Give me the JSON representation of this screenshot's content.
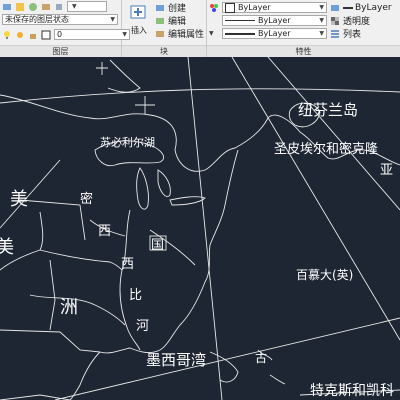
{
  "layers": {
    "row1_dropdown": "",
    "layer_state": "未保存的图层状态",
    "current_layer": "0",
    "title": "图层"
  },
  "block": {
    "insert_label": "插入",
    "create_label": "创建",
    "edit_label": "编辑",
    "edit_attributes_label": "编辑属性",
    "title": "块"
  },
  "properties": {
    "color": "ByLayer",
    "linetype": "ByLayer",
    "lineweight": "ByLayer",
    "title": "特性",
    "color_right": "ByLayer",
    "transparency_label": "透明度",
    "list_label": "列表"
  },
  "map_labels": {
    "newfoundland": "纽芬兰岛",
    "st_pierre": "圣皮埃尔和密克隆",
    "asia_fragment": "亚",
    "superior": "苏必利尔湖",
    "america_1": "美",
    "america_2": "美",
    "mi": "密",
    "xi": "西",
    "guo": "国",
    "xi2": "西",
    "bi": "比",
    "he": "河",
    "zhou": "洲",
    "bermuda": "百慕大(英)",
    "gulf_mexico": "墨西哥湾",
    "turks": "特克斯和凯科",
    "gu": "古"
  },
  "colors": {
    "canvas_bg": "#1e2633",
    "lines": "#e8e8e8",
    "ribbon_bg": "#f0f0f0"
  }
}
